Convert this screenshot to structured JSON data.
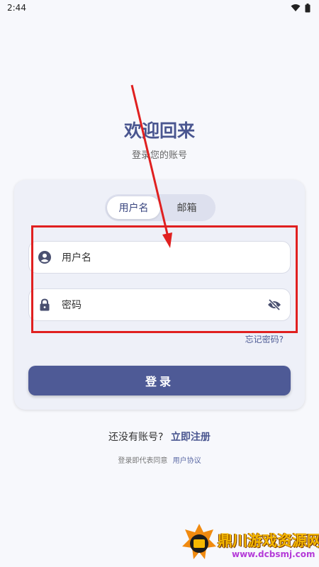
{
  "status_bar": {
    "time": "2:44",
    "wifi_icon": "wifi-icon",
    "battery_icon": "battery-icon"
  },
  "header": {
    "title": "欢迎回来",
    "subtitle": "登录您的账号"
  },
  "tabs": [
    {
      "label": "用户名",
      "active": true
    },
    {
      "label": "邮箱",
      "active": false
    }
  ],
  "form": {
    "username": {
      "placeholder": "用户名",
      "icon": "account-circle-icon"
    },
    "password": {
      "placeholder": "密码",
      "icon": "lock-icon",
      "toggle_icon": "eye-off-icon"
    },
    "forgot_label": "忘记密码?",
    "login_label": "登录"
  },
  "footer": {
    "no_account": "还没有账号?",
    "register_label": "立即注册",
    "agreement_prefix": "登录即代表同意",
    "agreement_link": "用户协议"
  },
  "watermark": {
    "brand": "鼎川游戏资源网",
    "url": "www.dcbsmj.com"
  },
  "colors": {
    "primary": "#4e5a96",
    "title": "#4a5690",
    "annotation": "#e02020"
  }
}
